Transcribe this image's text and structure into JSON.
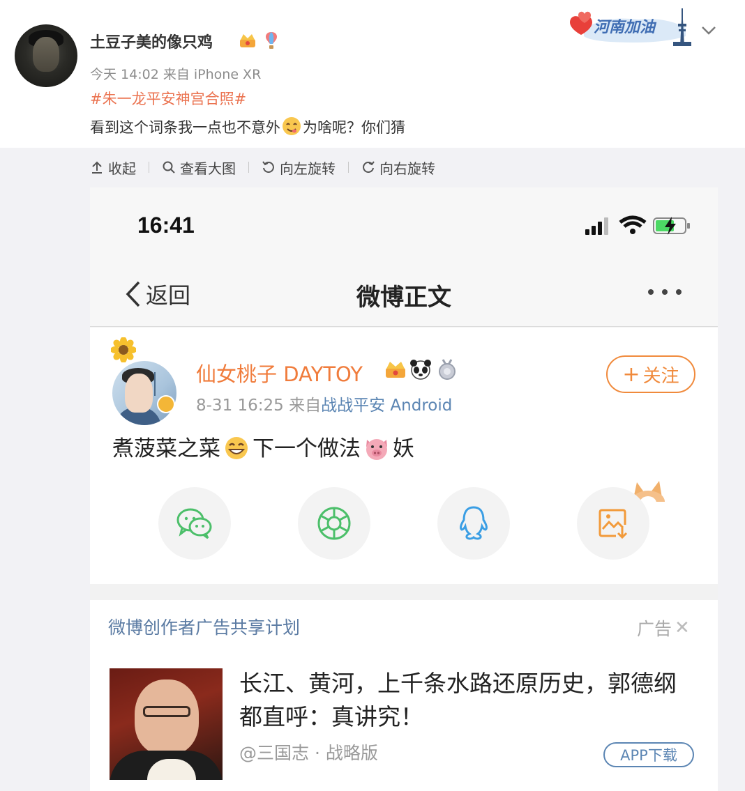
{
  "post": {
    "username": "土豆子美的像只鸡",
    "meta": "今天 14:02 来自 iPhone XR",
    "hashtag": "#朱一龙平安神宫合照#",
    "text_before_emoji": "看到这个词条我一点也不意外",
    "text_after_emoji": "为啥呢？你们猜",
    "campaign_logo_text": "河南加油"
  },
  "toolbar": {
    "collapse": "收起",
    "view_large": "查看大图",
    "rotate_left": "向左旋转",
    "rotate_right": "向右旋转"
  },
  "screenshot": {
    "status_time": "16:41",
    "nav_back": "返回",
    "nav_title": "微博正文",
    "inner_post": {
      "author": "仙女桃子 DAYTOY",
      "date": "8-31 16:25",
      "source_prefix": "来自",
      "source": "战战平安 Android",
      "text_part1": "煮菠菜之菜",
      "text_part2": "下一个做法",
      "text_part3": "妖",
      "follow_label": "关注",
      "share_icons": [
        "wechat-icon",
        "moments-icon",
        "qq-icon",
        "save-image-icon"
      ]
    },
    "ad": {
      "program": "微博创作者广告共享计划",
      "tag": "广告",
      "headline": "长江、黄河，上千条水路还原历史，郭德纲都直呼：真讲究！",
      "source": "@三国志 · 战略版",
      "button": "APP下载"
    }
  },
  "colors": {
    "hashtag": "#eb7350",
    "inner_author": "#f07c3c",
    "link_blue": "#5b85b3",
    "follow_orange": "#f08a3c"
  }
}
